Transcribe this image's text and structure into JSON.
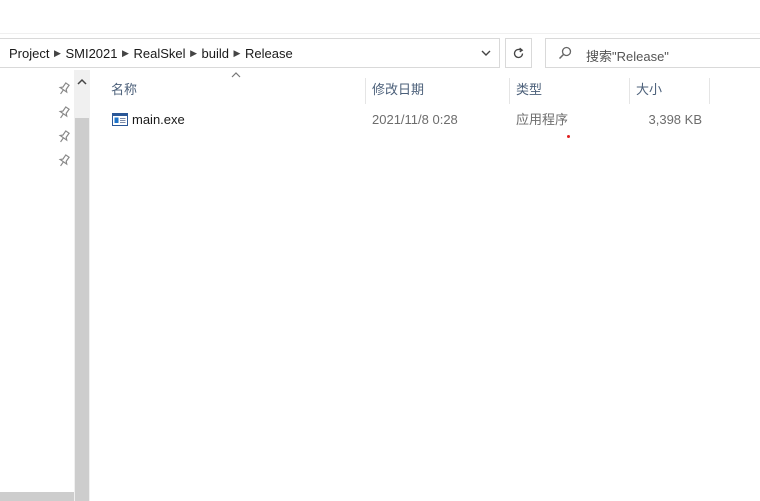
{
  "address_bar": {
    "path": [
      "Project",
      "SMI2021",
      "RealSkel",
      "build",
      "Release"
    ]
  },
  "search": {
    "placeholder": "搜索\"Release\""
  },
  "columns": {
    "name": "名称",
    "date": "修改日期",
    "type": "类型",
    "size": "大小"
  },
  "files": [
    {
      "name": "main.exe",
      "date": "2021/11/8 0:28",
      "type": "应用程序",
      "size": "3,398 KB"
    }
  ],
  "icons": {
    "breadcrumb_separator": "chevron-right-icon",
    "address_dropdown": "chevron-down-icon",
    "refresh": "refresh-icon",
    "search": "search-icon",
    "quick_access_pins": "pin-icon",
    "file": "exe-file-icon"
  },
  "colors": {
    "header_text": "#4c607a",
    "scroll_track": "#f0f0f0",
    "scroll_thumb": "#cdcdcd"
  }
}
